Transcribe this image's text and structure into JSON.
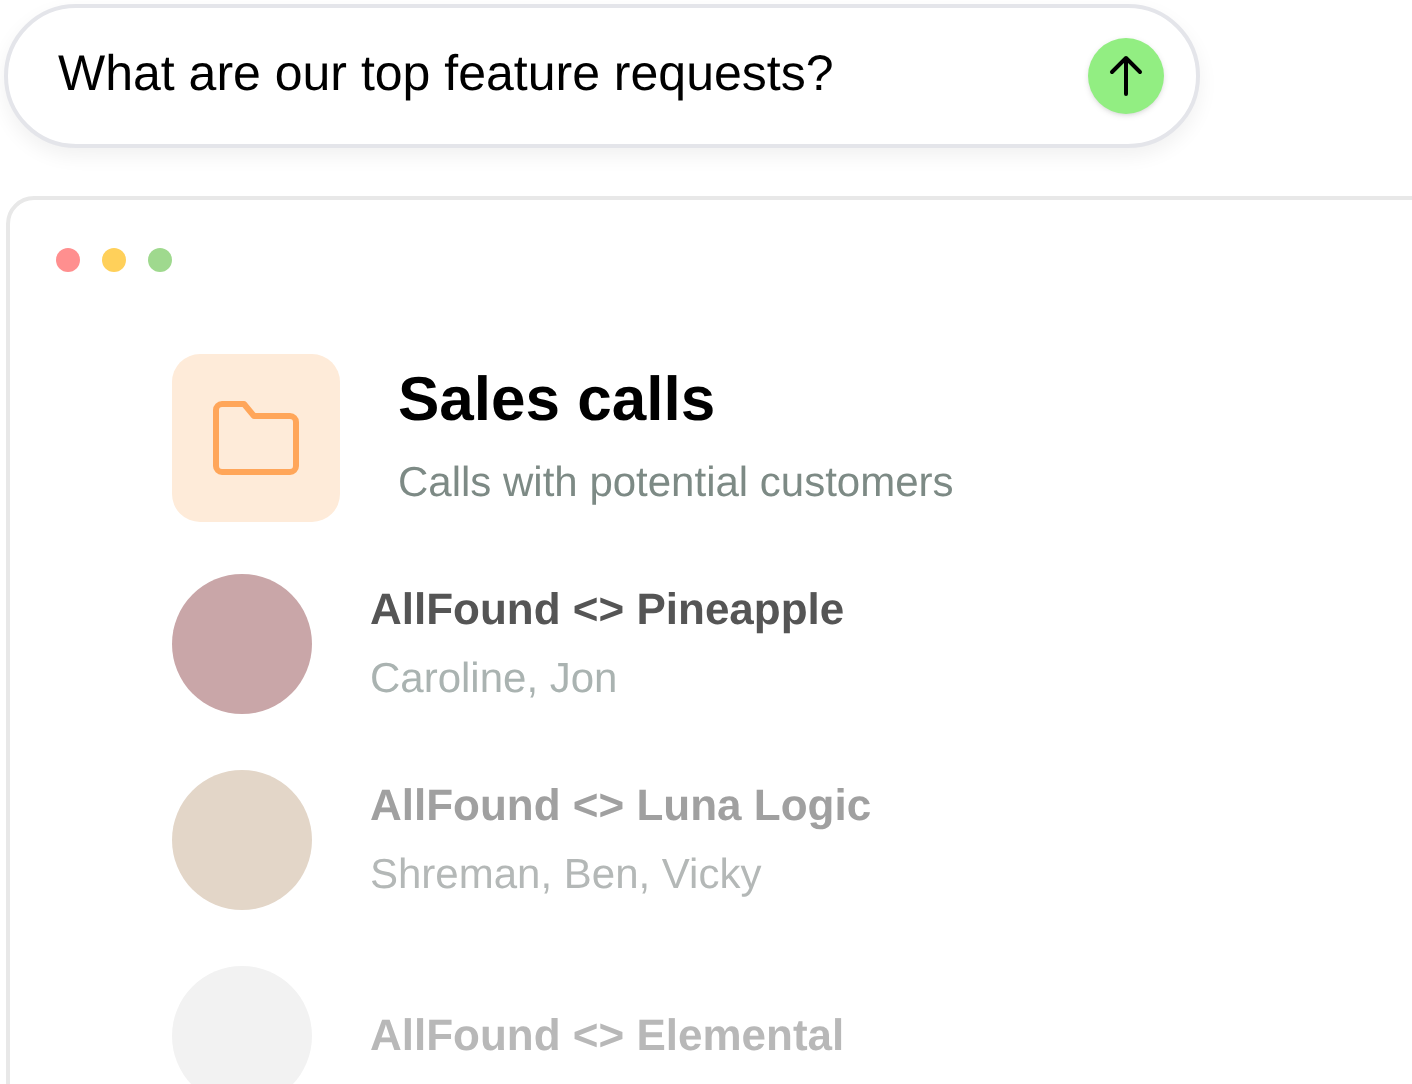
{
  "query": {
    "value": "What are our top feature requests?"
  },
  "folder": {
    "title": "Sales calls",
    "subtitle": "Calls with potential customers"
  },
  "calls": [
    {
      "title": "AllFound <> Pineapple",
      "participants": "Caroline, Jon"
    },
    {
      "title": "AllFound <> Luna Logic",
      "participants": "Shreman, Ben, Vicky"
    },
    {
      "title": "AllFound <> Elemental"
    }
  ]
}
